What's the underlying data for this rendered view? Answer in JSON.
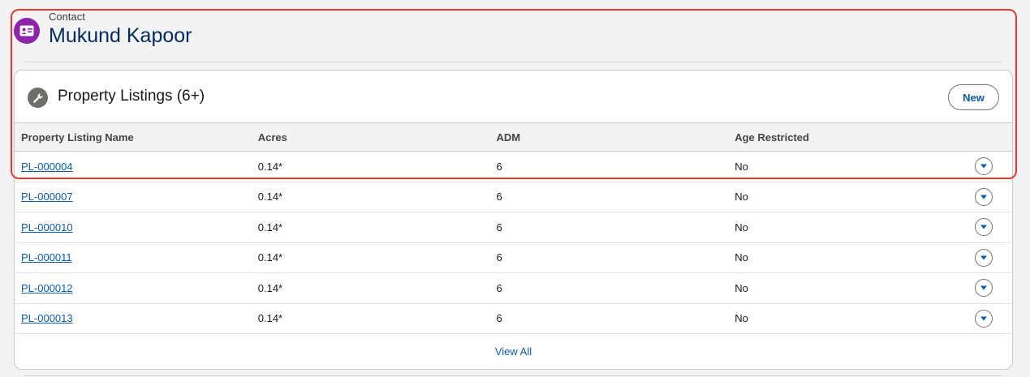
{
  "header": {
    "object_label": "Contact",
    "record_name": "Mukund Kapoor",
    "icon": "contact-card-icon"
  },
  "related_list": {
    "icon": "wrench-icon",
    "title": "Property Listings (6+)",
    "new_label": "New",
    "columns": [
      "Property Listing Name",
      "Acres",
      "ADM",
      "Age Restricted"
    ],
    "rows": [
      {
        "name": "PL-000004",
        "acres": "0.14*",
        "adm": "6",
        "age": "No"
      },
      {
        "name": "PL-000007",
        "acres": "0.14*",
        "adm": "6",
        "age": "No"
      },
      {
        "name": "PL-000010",
        "acres": "0.14*",
        "adm": "6",
        "age": "No"
      },
      {
        "name": "PL-000011",
        "acres": "0.14*",
        "adm": "6",
        "age": "No"
      },
      {
        "name": "PL-000012",
        "acres": "0.14*",
        "adm": "6",
        "age": "No"
      },
      {
        "name": "PL-000013",
        "acres": "0.14*",
        "adm": "6",
        "age": "No"
      }
    ],
    "view_all_label": "View All"
  },
  "colors": {
    "contact_icon": "#8e24aa",
    "link": "#0b5cab",
    "highlight": "#e8392f"
  }
}
